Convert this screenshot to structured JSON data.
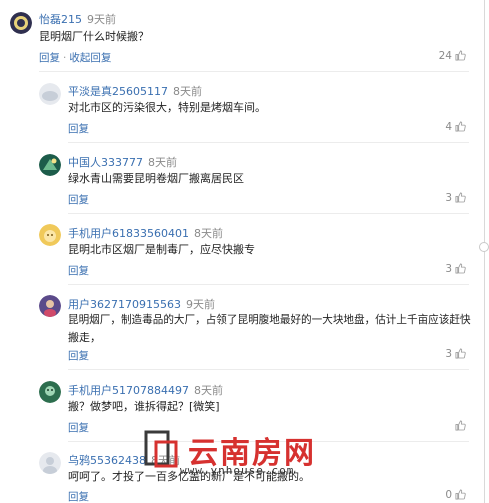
{
  "comment_main": {
    "username": "怡磊215",
    "time": "9天前",
    "text": "昆明烟厂什么时候搬？",
    "reply": "回复",
    "collapse": "收起回复",
    "likes": "24"
  },
  "replies": [
    {
      "username": "平淡是真25605117",
      "time": "8天前",
      "text": "对北市区的污染很大，特别是烤烟车间。",
      "reply": "回复",
      "likes": "4"
    },
    {
      "username": "中国人333777",
      "time": "8天前",
      "text": "绿水青山需要昆明卷烟厂搬离居民区",
      "reply": "回复",
      "likes": "3"
    },
    {
      "username": "手机用户61833560401",
      "time": "8天前",
      "text": "昆明北市区烟厂是制毒厂，应尽快搬专",
      "reply": "回复",
      "likes": "3"
    },
    {
      "username": "用户3627170915563",
      "time": "9天前",
      "text_line1": "昆明烟厂，制造毒品的大厂，占领了昆明腹地最好的一大块地盘，估计上千亩应该赶快",
      "text_line2": "搬走，",
      "reply": "回复",
      "likes": "3"
    },
    {
      "username": "手机用户51707884497",
      "time": "8天前",
      "text": "搬？做梦吧，谁拆得起？[微笑]",
      "reply": "回复",
      "likes": ""
    },
    {
      "username": "乌鸦55362438",
      "time": "8天前",
      "text": "呵呵了。才投了一百多亿盖的新厂是不可能搬的。",
      "reply": "回复",
      "likes": "0"
    }
  ],
  "watermark": {
    "title": "云南房网",
    "url": "www.ynhouse.com"
  },
  "colors": {
    "username": "#3a6fb0",
    "time": "#8a8a8a",
    "watermark_red": "#d6312f"
  },
  "icons": [
    "thumbs-up-icon",
    "avatar-icon"
  ]
}
